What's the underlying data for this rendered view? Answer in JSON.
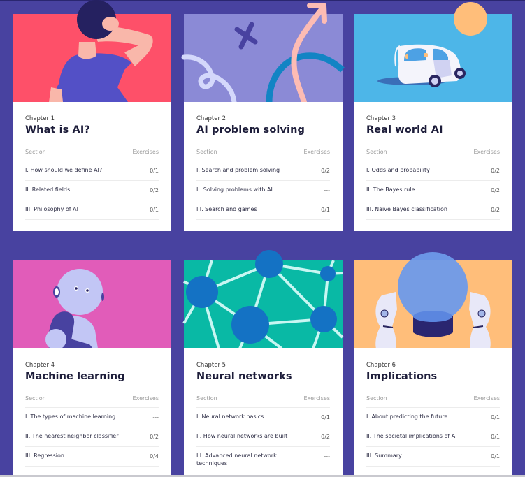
{
  "colors": {
    "background": "#4842a0",
    "card_body": "#ffffff",
    "chapter1_bg": "#fe5069",
    "chapter2_bg": "#8b8ad6",
    "chapter3_bg": "#4db6e8",
    "chapter4_bg": "#e15cb9",
    "chapter5_bg": "#09b9a5",
    "chapter6_bg": "#ffbe7a"
  },
  "table_headers": {
    "section": "Section",
    "exercises": "Exercises"
  },
  "chapters": [
    {
      "chapter_label": "Chapter 1",
      "title": "What is AI?",
      "illustration": "person-scratching-head",
      "sections": [
        {
          "name": "I. How should we define AI?",
          "exercises": "0/1"
        },
        {
          "name": "II. Related fields",
          "exercises": "0/2"
        },
        {
          "name": "III. Philosophy of AI",
          "exercises": "0/1"
        }
      ]
    },
    {
      "chapter_label": "Chapter 2",
      "title": "AI problem solving",
      "illustration": "squiggle-arrow",
      "sections": [
        {
          "name": "I. Search and problem solving",
          "exercises": "0/2"
        },
        {
          "name": "II. Solving problems with AI",
          "exercises": "---"
        },
        {
          "name": "III. Search and games",
          "exercises": "0/1"
        }
      ]
    },
    {
      "chapter_label": "Chapter 3",
      "title": "Real world AI",
      "illustration": "self-driving-car",
      "sections": [
        {
          "name": "I. Odds and probability",
          "exercises": "0/2"
        },
        {
          "name": "II. The Bayes rule",
          "exercises": "0/2"
        },
        {
          "name": "III. Naive Bayes classification",
          "exercises": "0/2"
        }
      ]
    },
    {
      "chapter_label": "Chapter 4",
      "title": "Machine learning",
      "illustration": "robot",
      "sections": [
        {
          "name": "I. The types of machine learning",
          "exercises": "---"
        },
        {
          "name": "II. The nearest neighbor classifier",
          "exercises": "0/2"
        },
        {
          "name": "III. Regression",
          "exercises": "0/4"
        }
      ]
    },
    {
      "chapter_label": "Chapter 5",
      "title": "Neural networks",
      "illustration": "network-nodes",
      "sections": [
        {
          "name": "I. Neural network basics",
          "exercises": "0/1"
        },
        {
          "name": "II. How neural networks are built",
          "exercises": "0/2"
        },
        {
          "name": "III. Advanced neural network techniques",
          "exercises": "---"
        }
      ]
    },
    {
      "chapter_label": "Chapter 6",
      "title": "Implications",
      "illustration": "robot-hands-crystal-ball",
      "sections": [
        {
          "name": "I. About predicting the future",
          "exercises": "0/1"
        },
        {
          "name": "II. The societal implications of AI",
          "exercises": "0/1"
        },
        {
          "name": "III. Summary",
          "exercises": "0/1"
        }
      ]
    }
  ]
}
